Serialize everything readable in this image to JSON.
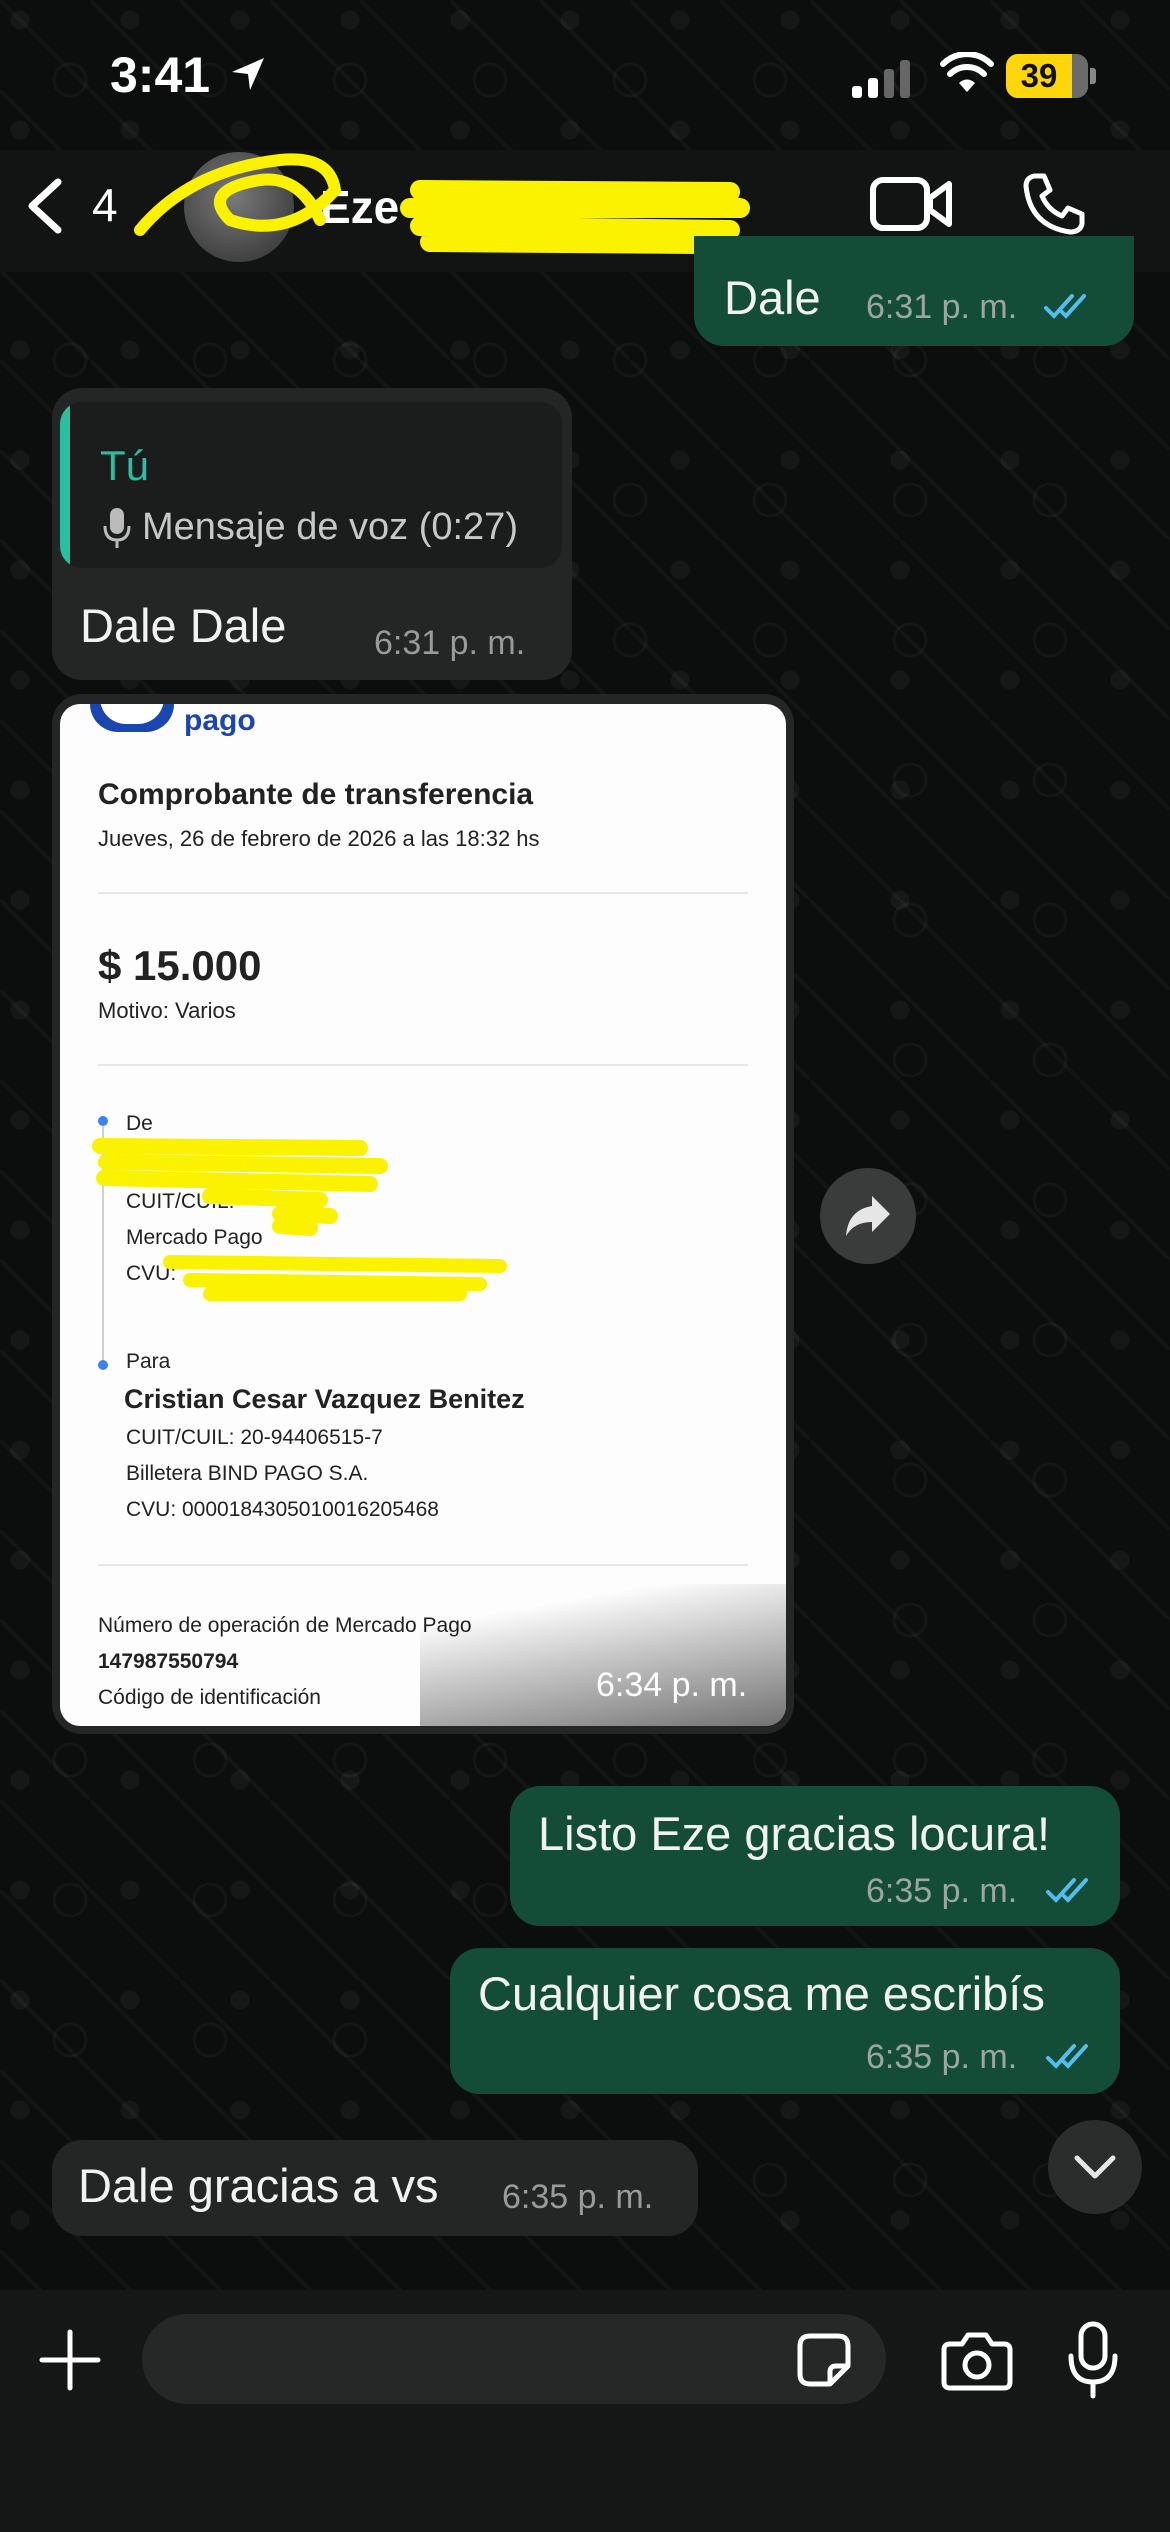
{
  "status_bar": {
    "time": "3:41",
    "battery": "39"
  },
  "header": {
    "back_count": "4",
    "contact_name": "Eze"
  },
  "messages": {
    "m1": {
      "text": "Dale",
      "time": "6:31 p. m."
    },
    "m2": {
      "quote_author": "Tú",
      "quote_text": "Mensaje de voz (0:27)",
      "text": "Dale Dale",
      "time": "6:31 p. m."
    },
    "m3": {
      "time": "6:34 p. m."
    },
    "m4": {
      "text": "Listo Eze gracias locura!",
      "time": "6:35 p. m."
    },
    "m5": {
      "text": "Cualquier cosa me escribís",
      "time": "6:35 p. m."
    },
    "m6": {
      "text": "Dale gracias a vs",
      "time": "6:35 p. m."
    }
  },
  "receipt": {
    "brand": "pago",
    "title": "Comprobante de transferencia",
    "date": "Jueves, 26 de febrero de 2026 a las 18:32 hs",
    "amount": "$ 15.000",
    "motive": "Motivo: Varios",
    "from_label": "De",
    "from_cuit": "CUIT/CUIL:",
    "from_bank": "Mercado Pago",
    "from_cvu": "CVU:",
    "to_label": "Para",
    "to_name": "Cristian Cesar Vazquez Benitez",
    "to_cuit": "CUIT/CUIL: 20-94406515-7",
    "to_bank": "Billetera BIND PAGO S.A.",
    "to_cvu": "CVU: 0000184305010016205468",
    "op_label": "Número de operación de Mercado Pago",
    "op_number": "147987550794",
    "id_label": "Código de identificación"
  },
  "colors": {
    "outgoing": "#144d37",
    "incoming": "#242626",
    "read_ticks": "#53bdeb",
    "accent": "#28c0a0",
    "battery": "#ffd60a"
  },
  "icons": [
    "back-chevron-icon",
    "video-call-icon",
    "phone-call-icon",
    "microphone-icon",
    "forward-icon",
    "scroll-down-icon",
    "plus-icon",
    "sticker-icon",
    "camera-icon",
    "mic-icon",
    "read-receipt-icon"
  ]
}
